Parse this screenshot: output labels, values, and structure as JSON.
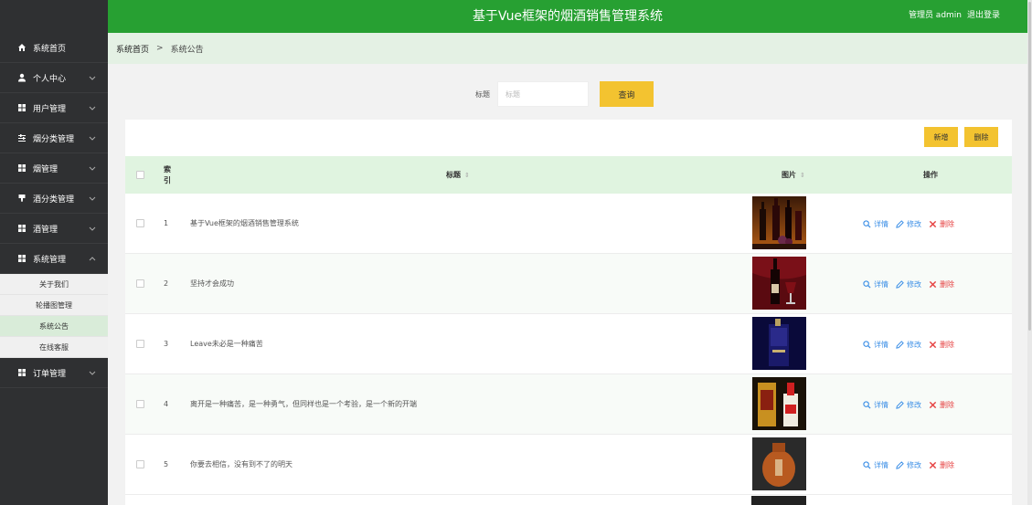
{
  "app": {
    "title": "基于Vue框架的烟酒销售管理系统",
    "user_label": "管理员 admin",
    "logout_label": "退出登录"
  },
  "sidebar": {
    "items": [
      {
        "label": "系统首页",
        "icon": "home-icon",
        "chevron": false
      },
      {
        "label": "个人中心",
        "icon": "user-icon",
        "chevron": true
      },
      {
        "label": "用户管理",
        "icon": "grid-icon",
        "chevron": true
      },
      {
        "label": "烟分类管理",
        "icon": "sliders-icon",
        "chevron": true
      },
      {
        "label": "烟管理",
        "icon": "grid-icon",
        "chevron": true
      },
      {
        "label": "酒分类管理",
        "icon": "cup-icon",
        "chevron": true
      },
      {
        "label": "酒管理",
        "icon": "grid-icon",
        "chevron": true
      },
      {
        "label": "系统管理",
        "icon": "grid-icon",
        "chevron": true,
        "expanded": true
      },
      {
        "label": "订单管理",
        "icon": "grid-icon",
        "chevron": true
      }
    ],
    "sub_items": [
      {
        "label": "关于我们",
        "active": false
      },
      {
        "label": "轮播图管理",
        "active": false
      },
      {
        "label": "系统公告",
        "active": true
      },
      {
        "label": "在线客服",
        "active": false
      }
    ]
  },
  "breadcrumb": {
    "home": "系统首页",
    "separator": ">",
    "current": "系统公告"
  },
  "search": {
    "label": "标题",
    "placeholder": "标题",
    "value": "",
    "button": "查询"
  },
  "toolbar": {
    "add": "新增",
    "delete": "删除"
  },
  "table": {
    "headers": {
      "index": "索\n引",
      "title": "标题",
      "image": "图片",
      "actions": "操作"
    },
    "actions": {
      "detail": "详情",
      "edit": "修改",
      "remove": "删除"
    },
    "rows": [
      {
        "index": "1",
        "title": "基于Vue框架的烟酒销售管理系统",
        "image": "wine-bottles-image"
      },
      {
        "index": "2",
        "title": "坚持才会成功",
        "image": "red-wine-image"
      },
      {
        "index": "3",
        "title": "Leave未必是一种痛苦",
        "image": "liquor-box-image"
      },
      {
        "index": "4",
        "title": "离开是一种痛苦，是一种勇气，但同样也是一个考验，是一个新的开端",
        "image": "baijiu-gift-image"
      },
      {
        "index": "5",
        "title": "你要去相信，没有到不了的明天",
        "image": "ceramic-jar-image"
      }
    ]
  },
  "colors": {
    "header_green": "#27a032",
    "sidebar_dark": "#2f3032",
    "accent_yellow": "#f3c330",
    "table_header": "#e0f4e0"
  }
}
